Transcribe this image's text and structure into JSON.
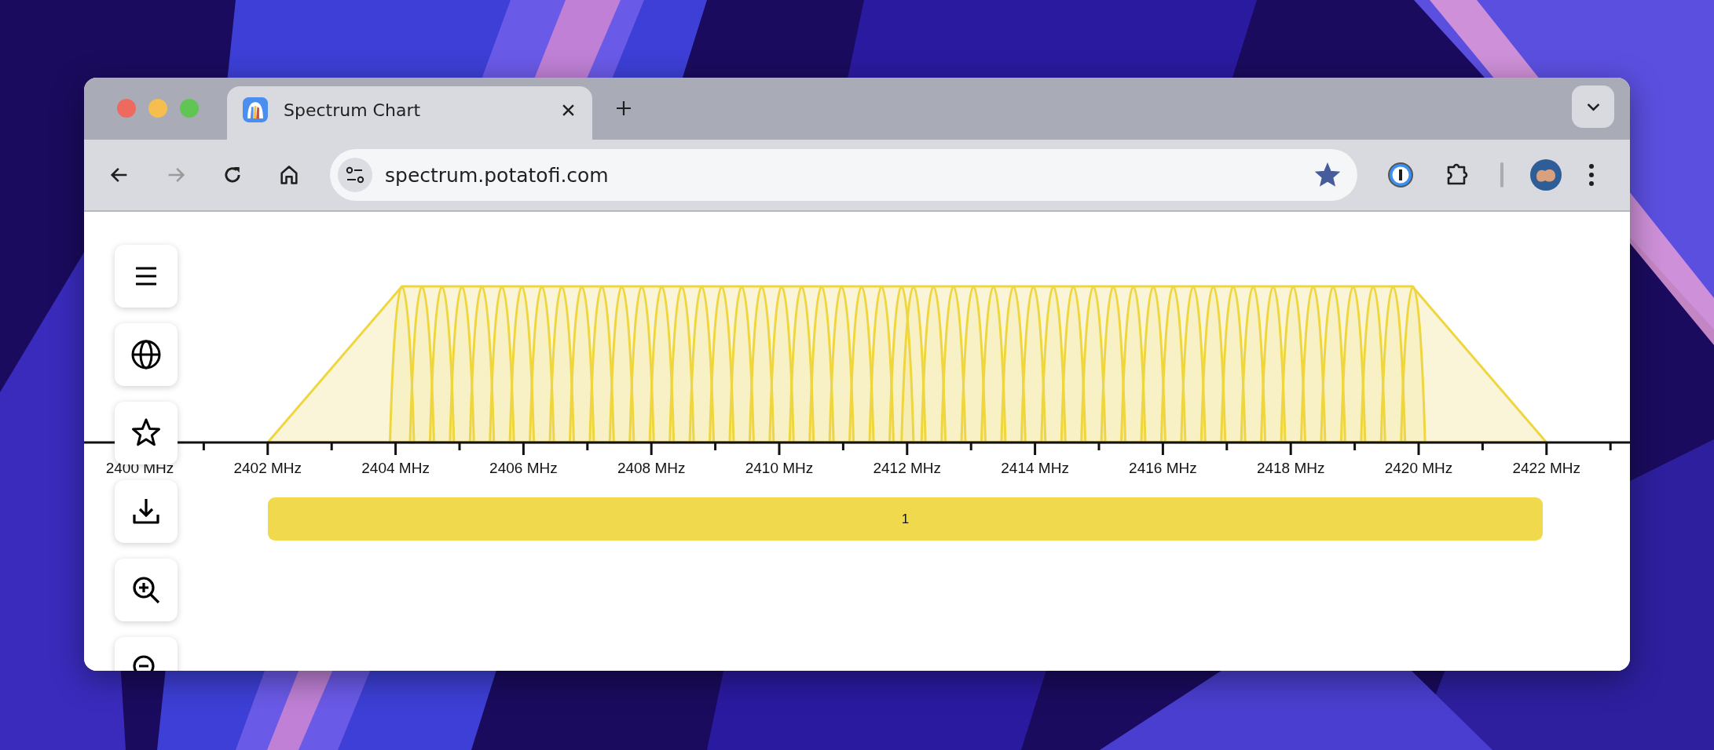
{
  "browser": {
    "tabs": [
      {
        "title": "Spectrum Chart",
        "selected": true
      }
    ],
    "navigation": {
      "back_disabled": false,
      "forward_disabled": true
    },
    "address_bar": {
      "url": "spectrum.potatofi.com",
      "bookmarked": true
    }
  },
  "chart": {
    "axis_labels": [
      "2400 MHz",
      "2402 MHz",
      "2404 MHz",
      "2406 MHz",
      "2408 MHz",
      "2410 MHz",
      "2412 MHz",
      "2414 MHz",
      "2416 MHz",
      "2418 MHz",
      "2420 MHz",
      "2422 MHz"
    ],
    "channels": [
      {
        "label": "1"
      }
    ]
  }
}
